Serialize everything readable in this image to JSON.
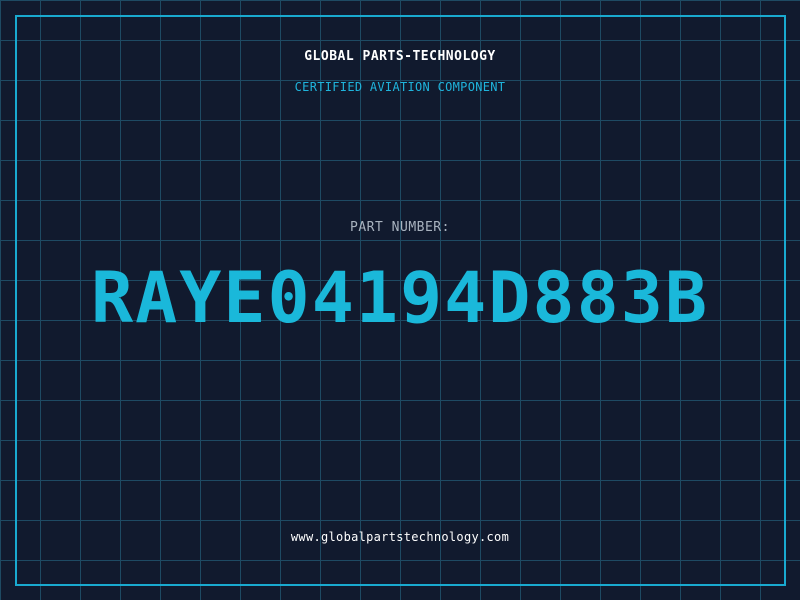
{
  "header": {
    "brand": "GLOBAL PARTS-TECHNOLOGY",
    "tagline": "CERTIFIED AVIATION COMPONENT"
  },
  "main": {
    "label": "PART NUMBER:",
    "part_number": "RAYE04194D883B"
  },
  "footer": {
    "website": "www.globalpartstechnology.com"
  },
  "colors": {
    "background": "#111a2e",
    "grid": "#1e4a63",
    "accent": "#19a9cf",
    "text_light": "#ffffff",
    "text_muted": "#a9b3bf"
  }
}
